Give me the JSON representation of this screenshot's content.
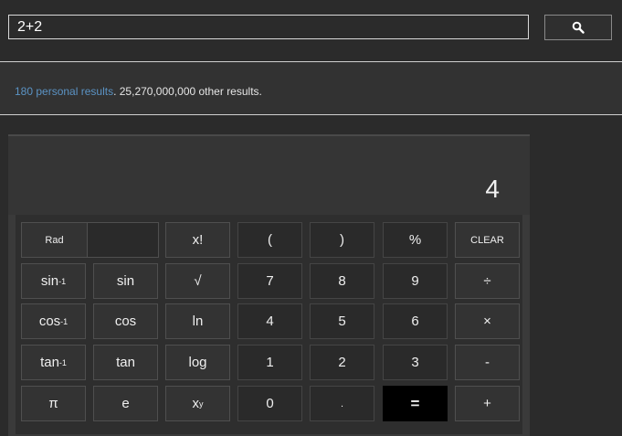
{
  "search": {
    "query": "2+2",
    "button_icon": "search-icon"
  },
  "results": {
    "personal_link": "180 personal results",
    "separator": ".",
    "other": " 25,270,000,000 other results."
  },
  "calculator": {
    "display": "4",
    "rows": [
      [
        {
          "name": "rad-button",
          "label": "Rad"
        },
        {
          "name": "factorial-button",
          "label": "x!"
        },
        {
          "name": "open-paren-button",
          "label": "("
        },
        {
          "name": "close-paren-button",
          "label": ")"
        },
        {
          "name": "percent-button",
          "label": "%"
        },
        {
          "name": "clear-button",
          "label": "CLEAR"
        }
      ],
      [
        {
          "name": "arcsin-button",
          "label": "sin",
          "sup": "-1"
        },
        {
          "name": "sin-button",
          "label": "sin"
        },
        {
          "name": "sqrt-button",
          "label": "√"
        },
        {
          "name": "digit-7-button",
          "label": "7"
        },
        {
          "name": "digit-8-button",
          "label": "8"
        },
        {
          "name": "digit-9-button",
          "label": "9"
        },
        {
          "name": "divide-button",
          "label": "÷"
        }
      ],
      [
        {
          "name": "arccos-button",
          "label": "cos",
          "sup": "-1"
        },
        {
          "name": "cos-button",
          "label": "cos"
        },
        {
          "name": "ln-button",
          "label": "ln"
        },
        {
          "name": "digit-4-button",
          "label": "4"
        },
        {
          "name": "digit-5-button",
          "label": "5"
        },
        {
          "name": "digit-6-button",
          "label": "6"
        },
        {
          "name": "multiply-button",
          "label": "×"
        }
      ],
      [
        {
          "name": "arctan-button",
          "label": "tan",
          "sup": "-1"
        },
        {
          "name": "tan-button",
          "label": "tan"
        },
        {
          "name": "log-button",
          "label": "log"
        },
        {
          "name": "digit-1-button",
          "label": "1"
        },
        {
          "name": "digit-2-button",
          "label": "2"
        },
        {
          "name": "digit-3-button",
          "label": "3"
        },
        {
          "name": "subtract-button",
          "label": "-"
        }
      ],
      [
        {
          "name": "pi-button",
          "label": "π"
        },
        {
          "name": "e-button",
          "label": "e"
        },
        {
          "name": "power-button",
          "label": "x",
          "sup": "y"
        },
        {
          "name": "digit-0-button",
          "label": "0"
        },
        {
          "name": "decimal-button",
          "label": "."
        },
        {
          "name": "equals-button",
          "label": "="
        },
        {
          "name": "add-button",
          "label": "+"
        }
      ]
    ]
  }
}
